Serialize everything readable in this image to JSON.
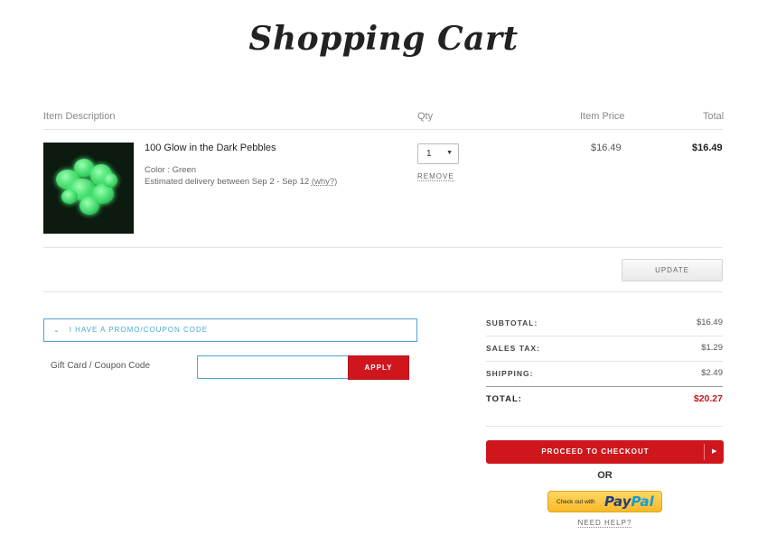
{
  "page": {
    "title": "Shopping Cart"
  },
  "cart_table": {
    "headers": {
      "description": "Item Description",
      "qty": "Qty",
      "price": "Item Price",
      "total": "Total"
    },
    "items": [
      {
        "name": "100 Glow in the Dark Pebbles",
        "color": "Color : Green",
        "delivery": "Estimated delivery between Sep 2 - Sep 12",
        "why_link": "(why?)",
        "qty": "1",
        "remove_label": "REMOVE",
        "price": "$16.49",
        "total": "$16.49"
      }
    ],
    "update_label": "UPDATE"
  },
  "promo": {
    "toggle_label": "I HAVE A PROMO/COUPON CODE",
    "field_label": "Gift Card / Coupon Code",
    "input_value": "",
    "apply_label": "APPLY"
  },
  "summary": {
    "subtotal_label": "SUBTOTAL:",
    "subtotal_value": "$16.49",
    "tax_label": "SALES TAX:",
    "tax_value": "$1.29",
    "shipping_label": "SHIPPING:",
    "shipping_value": "$2.49",
    "total_label": "TOTAL:",
    "total_value": "$20.27"
  },
  "checkout": {
    "proceed_label": "PROCEED TO CHECKOUT",
    "or_label": "OR",
    "paypal_small": "Check out with",
    "paypal_pay": "Pay",
    "paypal_pal": "Pal",
    "need_help": "NEED HELP?"
  },
  "colors": {
    "accent_red": "#d0161d",
    "link_blue": "#4aa7d1",
    "total_red": "#c8161d"
  }
}
